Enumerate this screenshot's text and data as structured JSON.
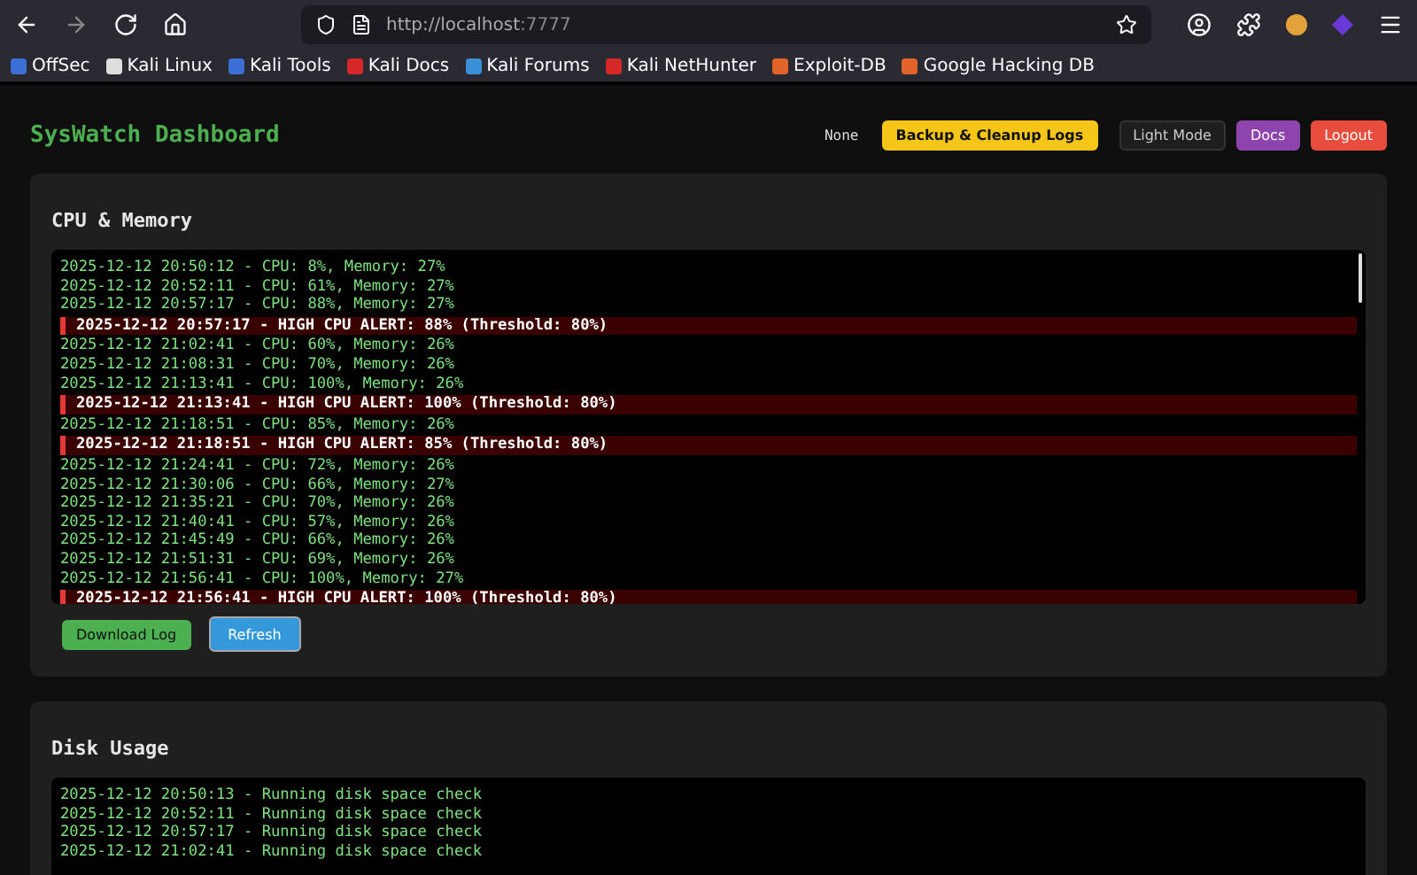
{
  "browser": {
    "url_host": "http://localhost",
    "url_port": ":7777",
    "bookmarks": [
      {
        "label": "OffSec",
        "color": "#3b6fd6"
      },
      {
        "label": "Kali Linux",
        "color": "#dddddd"
      },
      {
        "label": "Kali Tools",
        "color": "#3b6fd6"
      },
      {
        "label": "Kali Docs",
        "color": "#d62828"
      },
      {
        "label": "Kali Forums",
        "color": "#3b8fd6"
      },
      {
        "label": "Kali NetHunter",
        "color": "#d62828"
      },
      {
        "label": "Exploit-DB",
        "color": "#e2642a"
      },
      {
        "label": "Google Hacking DB",
        "color": "#e2642a"
      }
    ]
  },
  "header": {
    "title": "SysWatch Dashboard",
    "status": "None",
    "buttons": [
      {
        "label": "Backup & Cleanup Logs",
        "kind": "warning"
      },
      {
        "label": "Light Mode",
        "kind": "dark"
      },
      {
        "label": "Docs",
        "kind": "purple"
      },
      {
        "label": "Logout",
        "kind": "danger"
      }
    ]
  },
  "cpu_panel": {
    "title": "CPU & Memory",
    "log": [
      {
        "kind": "normal",
        "text": "2025-12-12 20:50:12 - CPU: 8%, Memory: 27%"
      },
      {
        "kind": "normal",
        "text": "2025-12-12 20:52:11 - CPU: 61%, Memory: 27%"
      },
      {
        "kind": "normal",
        "text": "2025-12-12 20:57:17 - CPU: 88%, Memory: 27%"
      },
      {
        "kind": "alert",
        "text": "2025-12-12 20:57:17 - HIGH CPU ALERT: 88% (Threshold: 80%)"
      },
      {
        "kind": "normal",
        "text": "2025-12-12 21:02:41 - CPU: 60%, Memory: 26%"
      },
      {
        "kind": "normal",
        "text": "2025-12-12 21:08:31 - CPU: 70%, Memory: 26%"
      },
      {
        "kind": "normal",
        "text": "2025-12-12 21:13:41 - CPU: 100%, Memory: 26%"
      },
      {
        "kind": "alert",
        "text": "2025-12-12 21:13:41 - HIGH CPU ALERT: 100% (Threshold: 80%)"
      },
      {
        "kind": "normal",
        "text": "2025-12-12 21:18:51 - CPU: 85%, Memory: 26%"
      },
      {
        "kind": "alert",
        "text": "2025-12-12 21:18:51 - HIGH CPU ALERT: 85% (Threshold: 80%)"
      },
      {
        "kind": "normal",
        "text": "2025-12-12 21:24:41 - CPU: 72%, Memory: 26%"
      },
      {
        "kind": "normal",
        "text": "2025-12-12 21:30:06 - CPU: 66%, Memory: 27%"
      },
      {
        "kind": "normal",
        "text": "2025-12-12 21:35:21 - CPU: 70%, Memory: 26%"
      },
      {
        "kind": "normal",
        "text": "2025-12-12 21:40:41 - CPU: 57%, Memory: 26%"
      },
      {
        "kind": "normal",
        "text": "2025-12-12 21:45:49 - CPU: 66%, Memory: 26%"
      },
      {
        "kind": "normal",
        "text": "2025-12-12 21:51:31 - CPU: 69%, Memory: 26%"
      },
      {
        "kind": "normal",
        "text": "2025-12-12 21:56:41 - CPU: 100%, Memory: 27%"
      },
      {
        "kind": "alert",
        "text": "2025-12-12 21:56:41 - HIGH CPU ALERT: 100% (Threshold: 80%)"
      }
    ],
    "buttons": [
      {
        "label": "Download Log",
        "kind": "success"
      },
      {
        "label": "Refresh",
        "kind": "info"
      }
    ]
  },
  "disk_panel": {
    "title": "Disk Usage",
    "log": [
      "2025-12-12 20:50:13 - Running disk space check",
      "2025-12-12 20:52:11 - Running disk space check",
      "2025-12-12 20:57:17 - Running disk space check",
      "2025-12-12 21:02:41 - Running disk space check"
    ]
  }
}
